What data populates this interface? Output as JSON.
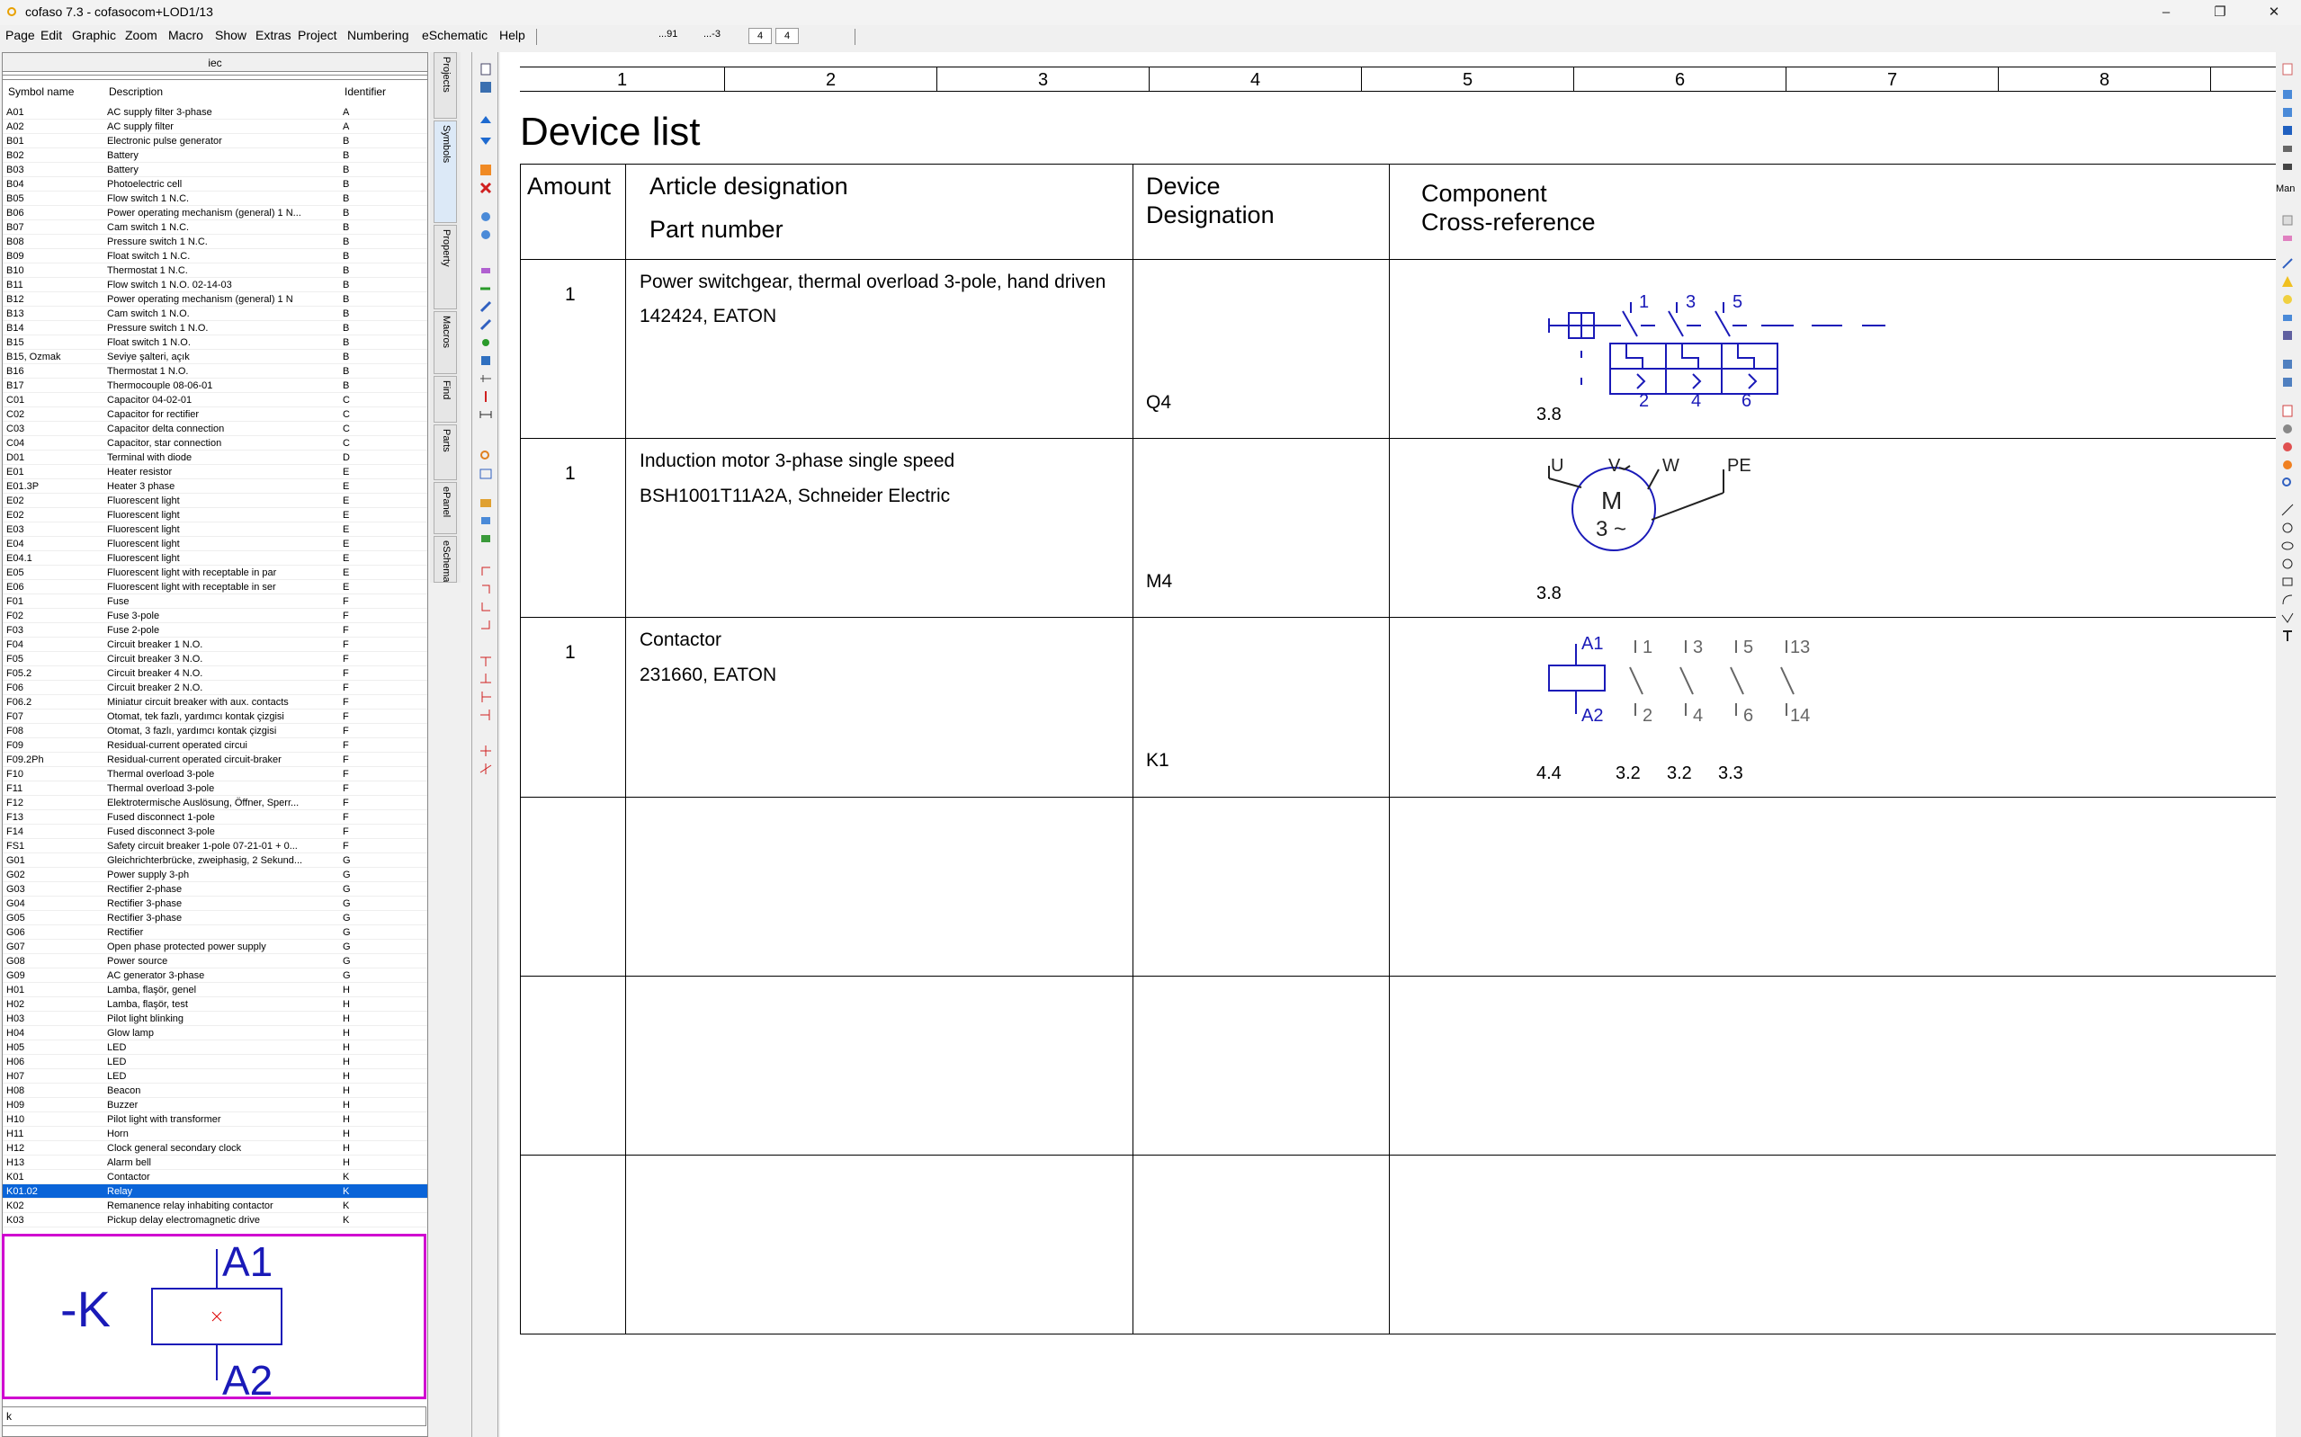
{
  "window": {
    "title": "cofaso 7.3 - cofasocom+LOD1/13",
    "minimize": "–",
    "maximize": "❐",
    "close": "✕"
  },
  "menu": [
    "Page",
    "Edit",
    "Graphic",
    "Zoom",
    "Macro",
    "Show",
    "Extras",
    "Project",
    "Numbering",
    "eSchematic",
    "Help"
  ],
  "menubar_fields": {
    "f1": "...91",
    "f2": "...-3",
    "f3": "4",
    "f4": "4"
  },
  "library": {
    "header": "iec",
    "columns": {
      "symbol": "Symbol name",
      "description": "Description",
      "identifier": "Identifier"
    },
    "rows": [
      [
        "A01",
        "AC supply filter 3-phase",
        "A"
      ],
      [
        "A02",
        "AC supply filter",
        "A"
      ],
      [
        "B01",
        "Electronic pulse generator",
        "B"
      ],
      [
        "B02",
        "Battery",
        "B"
      ],
      [
        "B03",
        "Battery",
        "B"
      ],
      [
        "B04",
        "Photoelectric cell",
        "B"
      ],
      [
        "B05",
        "Flow switch 1 N.C.",
        "B"
      ],
      [
        "B06",
        "Power operating mechanism (general) 1 N...",
        "B"
      ],
      [
        "B07",
        "Cam switch 1 N.C.",
        "B"
      ],
      [
        "B08",
        "Pressure switch 1 N.C.",
        "B"
      ],
      [
        "B09",
        "Float switch 1 N.C.",
        "B"
      ],
      [
        "B10",
        "Thermostat 1 N.C.",
        "B"
      ],
      [
        "B11",
        "Flow switch 1 N.O. 02-14-03",
        "B"
      ],
      [
        "B12",
        "Power operating mechanism (general) 1 N",
        "B"
      ],
      [
        "B13",
        "Cam switch 1 N.O.",
        "B"
      ],
      [
        "B14",
        "Pressure switch 1 N.O.",
        "B"
      ],
      [
        "B15",
        "Float switch 1 N.O.",
        "B"
      ],
      [
        "B15, Ozmak",
        "Seviye şalteri, açık",
        "B"
      ],
      [
        "B16",
        "Thermostat 1 N.O.",
        "B"
      ],
      [
        "B17",
        "Thermocouple 08-06-01",
        "B"
      ],
      [
        "C01",
        "Capacitor 04-02-01",
        "C"
      ],
      [
        "C02",
        "Capacitor for rectifier",
        "C"
      ],
      [
        "C03",
        "Capacitor delta connection",
        "C"
      ],
      [
        "C04",
        "Capacitor, star connection",
        "C"
      ],
      [
        "D01",
        "Terminal with diode",
        "D"
      ],
      [
        "E01",
        "Heater resistor",
        "E"
      ],
      [
        "E01.3P",
        "Heater 3 phase",
        "E"
      ],
      [
        "E02",
        "Fluorescent light",
        "E"
      ],
      [
        "E02",
        "Fluorescent light",
        "E"
      ],
      [
        "E03",
        "Fluorescent light",
        "E"
      ],
      [
        "E04",
        "Fluorescent light",
        "E"
      ],
      [
        "E04.1",
        "Fluorescent light",
        "E"
      ],
      [
        "E05",
        "Fluorescent light with receptable in par",
        "E"
      ],
      [
        "E06",
        "Fluorescent light with receptable in ser",
        "E"
      ],
      [
        "F01",
        "Fuse",
        "F"
      ],
      [
        "F02",
        "Fuse 3-pole",
        "F"
      ],
      [
        "F03",
        "Fuse 2-pole",
        "F"
      ],
      [
        "F04",
        "Circuit breaker 1 N.O.",
        "F"
      ],
      [
        "F05",
        "Circuit breaker 3 N.O.",
        "F"
      ],
      [
        "F05.2",
        "Circuit breaker 4 N.O.",
        "F"
      ],
      [
        "F06",
        "Circuit breaker 2 N.O.",
        "F"
      ],
      [
        "F06.2",
        "Miniatur circuit breaker with aux. contacts",
        "F"
      ],
      [
        "F07",
        "Otomat, tek fazlı, yardımcı kontak çizgisi",
        "F"
      ],
      [
        "F08",
        "Otomat, 3 fazlı, yardımcı kontak çizgisi",
        "F"
      ],
      [
        "F09",
        "Residual-current operated circui",
        "F"
      ],
      [
        "F09.2Ph",
        "Residual-current operated circuit-braker",
        "F"
      ],
      [
        "F10",
        "Thermal overload 3-pole",
        "F"
      ],
      [
        "F11",
        "Thermal overload 3-pole",
        "F"
      ],
      [
        "F12",
        "Elektrotermische Auslösung, Öffner, Sperr...",
        "F"
      ],
      [
        "F13",
        "Fused disconnect 1-pole",
        "F"
      ],
      [
        "F14",
        "Fused disconnect 3-pole",
        "F"
      ],
      [
        "FS1",
        "Safety circuit breaker 1-pole 07-21-01 + 0...",
        "F"
      ],
      [
        "G01",
        "Gleichrichterbrücke, zweiphasig, 2 Sekund...",
        "G"
      ],
      [
        "G02",
        "Power supply 3-ph",
        "G"
      ],
      [
        "G03",
        "Rectifier 2-phase",
        "G"
      ],
      [
        "G04",
        "Rectifier 3-phase",
        "G"
      ],
      [
        "G05",
        "Rectifier 3-phase",
        "G"
      ],
      [
        "G06",
        "Rectifier",
        "G"
      ],
      [
        "G07",
        "Open phase protected power supply",
        "G"
      ],
      [
        "G08",
        "Power source",
        "G"
      ],
      [
        "G09",
        "AC generator 3-phase",
        "G"
      ],
      [
        "H01",
        "Lamba, flaşör, genel",
        "H"
      ],
      [
        "H02",
        "Lamba, flaşör, test",
        "H"
      ],
      [
        "H03",
        "Pilot light blinking",
        "H"
      ],
      [
        "H04",
        "Glow lamp",
        "H"
      ],
      [
        "H05",
        "LED",
        "H"
      ],
      [
        "H06",
        "LED",
        "H"
      ],
      [
        "H07",
        "LED",
        "H"
      ],
      [
        "H08",
        "Beacon",
        "H"
      ],
      [
        "H09",
        "Buzzer",
        "H"
      ],
      [
        "H10",
        "Pilot light with transformer",
        "H"
      ],
      [
        "H11",
        "Horn",
        "H"
      ],
      [
        "H12",
        "Clock general secondary clock",
        "H"
      ],
      [
        "H13",
        "Alarm bell",
        "H"
      ],
      [
        "K01",
        "Contactor",
        "K"
      ],
      [
        "K01.02",
        "Relay",
        "K"
      ],
      [
        "K02",
        "Remanence relay inhabiting contactor",
        "K"
      ],
      [
        "K03",
        "Pickup delay electromagnetic drive",
        "K"
      ]
    ],
    "selected_index": 75,
    "preview": {
      "prefix": "-K",
      "top": "A1",
      "bottom": "A2"
    },
    "search_value": "k"
  },
  "side_tabs": [
    "Projects",
    "Symbols",
    "Property",
    "Macros",
    "Find",
    "Parts",
    "ePanel",
    "eSchematic"
  ],
  "ruler": [
    "1",
    "2",
    "3",
    "4",
    "5",
    "6",
    "7",
    "8"
  ],
  "document": {
    "title": "Device list",
    "headers": {
      "amount": "Amount",
      "article": "Article designation",
      "part": "Part number",
      "device1": "Device",
      "device2": "Designation",
      "component1": "Component",
      "component2": "Cross-reference"
    },
    "rows": [
      {
        "amount": "1",
        "article": "Power switchgear, thermal overload 3-pole, hand driven",
        "part": "142424, EATON",
        "designation": "Q4",
        "refs": [
          "3.8"
        ]
      },
      {
        "amount": "1",
        "article": "Induction motor 3-phase single speed",
        "part": "BSH1001T11A2A, Schneider Electric",
        "designation": "M4",
        "refs": [
          "3.8"
        ]
      },
      {
        "amount": "1",
        "article": "Contactor",
        "part": "231660, EATON",
        "designation": "K1",
        "refs": [
          "4.4",
          "3.2",
          "3.2",
          "3.3"
        ]
      }
    ],
    "symbols": {
      "q4_terms": [
        "1",
        "3",
        "5",
        "2",
        "4",
        "6"
      ],
      "m4_terms": [
        "U",
        "V",
        "W",
        "PE"
      ],
      "m4_label": "M",
      "m4_sub": "3 ~",
      "k1_coil": [
        "A1",
        "A2"
      ],
      "k1_contacts": [
        "1",
        "3",
        "5",
        "13",
        "2",
        "4",
        "6",
        "14"
      ]
    }
  },
  "right_strip_label": "Man"
}
